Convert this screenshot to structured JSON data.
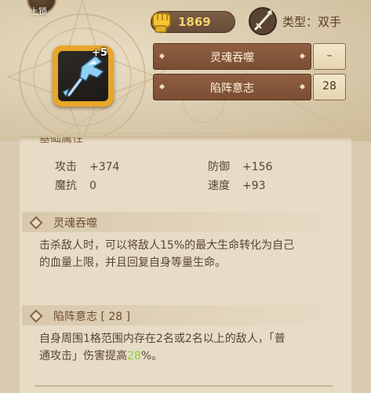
{
  "header": {
    "lock_label": "上锁",
    "item": {
      "icon": "frost-battle-axe-icon",
      "plus_level": "+5"
    },
    "power": {
      "icon": "gold-fist-icon",
      "value": "1869"
    },
    "type": {
      "icon": "spear-cross-icon",
      "label": "类型：双手"
    },
    "skills": [
      {
        "name": "灵魂吞噬",
        "value": "–"
      },
      {
        "name": "陷阵意志",
        "value": "28"
      }
    ]
  },
  "stats": {
    "cut_title": "基础属性",
    "items": [
      {
        "key": "攻击",
        "value": "+374"
      },
      {
        "key": "防御",
        "value": "+156"
      },
      {
        "key": "魔抗",
        "value": "0"
      },
      {
        "key": "速度",
        "value": "+93"
      }
    ]
  },
  "sections": [
    {
      "title": "灵魂吞噬",
      "lines": [
        "击杀敌人时，可以将敌人15%的最大生命转化为自己",
        "的血量上限，并且回复自身等量生命。"
      ]
    },
    {
      "title": "陷阵意志 [ 28 ]",
      "line1": "自身周围1格范围内存在2名或2名以上的敌人，「普",
      "line2_pre": "通攻击」伤害提高",
      "line2_hl": "28",
      "line2_post": "%。"
    }
  ],
  "colors": {
    "accent_gold": "#e8a62b",
    "skill_bar": "#8f5f42",
    "highlight_green": "#8fcf3c",
    "power_text": "#f3d36a"
  }
}
